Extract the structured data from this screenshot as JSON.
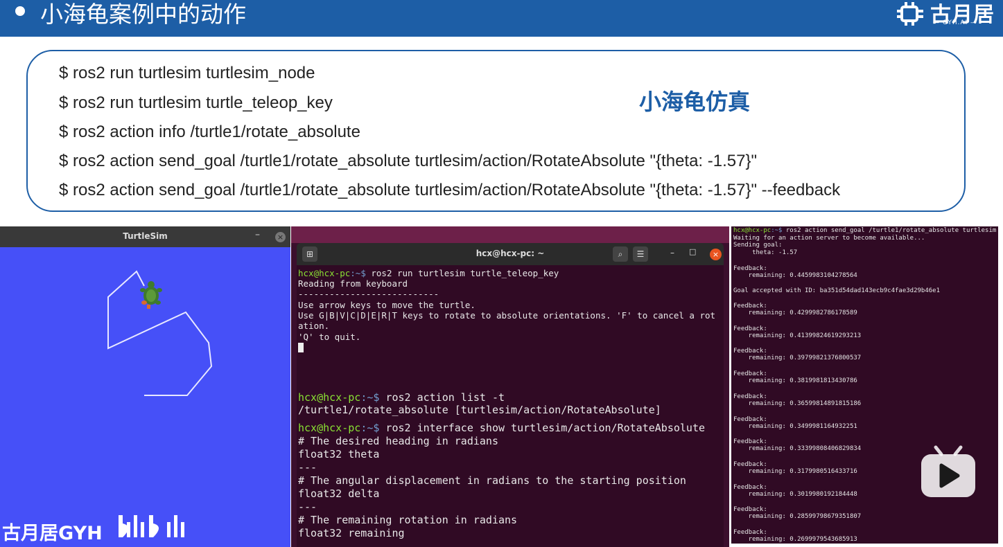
{
  "header": {
    "title": "小海龟案例中的动作",
    "logo_text": "古月居",
    "logo_sub": "— GYH.AI —"
  },
  "commands": [
    "$ ros2 run turtlesim turtlesim_node",
    "$ ros2 run turtlesim turtle_teleop_key",
    "$ ros2 action info /turtle1/rotate_absolute",
    "$ ros2 action send_goal /turtle1/rotate_absolute turtlesim/action/RotateAbsolute \"{theta: -1.57}\"",
    "$ ros2 action send_goal /turtle1/rotate_absolute turtlesim/action/RotateAbsolute \"{theta: -1.57}\" --feedback"
  ],
  "sim_label": "小海龟仿真",
  "turtlesim": {
    "title": "TurtleSim",
    "min_icon": "–",
    "close_icon": "×",
    "bg_color": "#4650f8"
  },
  "watermark": {
    "text": "古月居GYH",
    "brand": "bilibili"
  },
  "terminal": {
    "title": "hcx@hcx-pc: ~",
    "prompt_user": "hcx@hcx-pc",
    "prompt_path": ":~$",
    "teleop": {
      "cmd": " ros2 run turtlesim turtle_teleop_key",
      "lines": [
        "Reading from keyboard",
        "---------------------------",
        "Use arrow keys to move the turtle.",
        "Use G|B|V|C|D|E|R|T keys to rotate to absolute orientations. 'F' to cancel a rot",
        "ation.",
        "'Q' to quit."
      ]
    },
    "action_list": {
      "cmd": " ros2 action list -t",
      "output": "/turtle1/rotate_absolute [turtlesim/action/RotateAbsolute]"
    },
    "interface": {
      "cmd": " ros2 interface show turtlesim/action/RotateAbsolute",
      "lines": [
        "# The desired heading in radians",
        "float32 theta",
        "---",
        "# The angular displacement in radians to the starting position",
        "float32 delta",
        "---",
        "# The remaining rotation in radians",
        "float32 remaining"
      ]
    }
  },
  "feedback_terminal": {
    "cmd": " ros2 action send_goal /turtle1/rotate_absolute turtlesim",
    "header_lines": [
      "Waiting for an action server to become available...",
      "Sending goal:",
      "     theta: -1.57"
    ],
    "first_feedback": "    remaining: 0.4459983104278564",
    "goal_accepted": "Goal accepted with ID: ba351d54dad143ecb9c4fae3d29b46e1",
    "feedback_label": "Feedback:",
    "remaining": [
      "    remaining: 0.4299982786178589",
      "    remaining: 0.41399824619293213",
      "    remaining: 0.39799821376800537",
      "    remaining: 0.3819981813430786",
      "    remaining: 0.36599814891815186",
      "    remaining: 0.3499981164932251",
      "    remaining: 0.33399808406829834",
      "    remaining: 0.3179980516433716",
      "    remaining: 0.3019980192184448",
      "    remaining: 0.28599798679351807",
      "    remaining: 0.2699979543685913"
    ]
  }
}
